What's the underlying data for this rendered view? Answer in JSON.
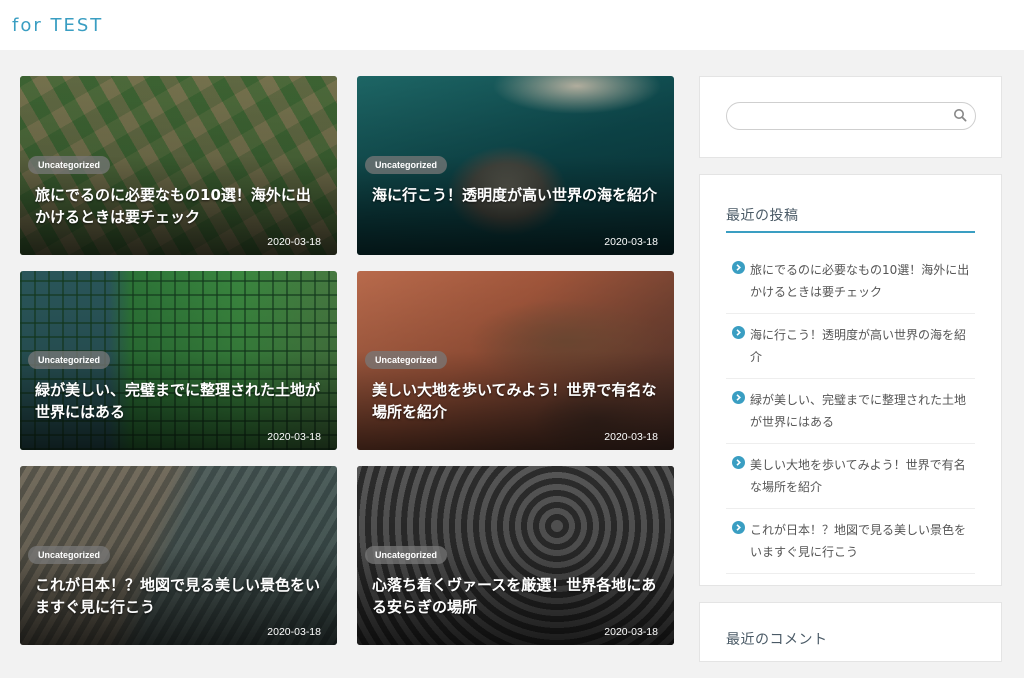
{
  "site": {
    "title": "for TEST"
  },
  "posts": [
    {
      "category": "Uncategorized",
      "title": "旅にでるのに必要なもの10選！海外に出かけるときは要チェック",
      "date": "2020-03-18"
    },
    {
      "category": "Uncategorized",
      "title": "海に行こう！透明度が高い世界の海を紹介",
      "date": "2020-03-18"
    },
    {
      "category": "Uncategorized",
      "title": "緑が美しい、完璧までに整理された土地が世界にはある",
      "date": "2020-03-18"
    },
    {
      "category": "Uncategorized",
      "title": "美しい大地を歩いてみよう！世界で有名な場所を紹介",
      "date": "2020-03-18"
    },
    {
      "category": "Uncategorized",
      "title": "これが日本！？地図で見る美しい景色をいますぐ見に行こう",
      "date": "2020-03-18"
    },
    {
      "category": "Uncategorized",
      "title": "心落ち着くヴァースを厳選！世界各地にある安らぎの場所",
      "date": "2020-03-18"
    }
  ],
  "sidebar": {
    "search": {
      "placeholder": "",
      "icon": "search-icon"
    },
    "recent": {
      "title": "最近の投稿",
      "items": [
        "旅にでるのに必要なもの10選！海外に出かけるときは要チェック",
        "海に行こう！透明度が高い世界の海を紹介",
        "緑が美しい、完璧までに整理された土地が世界にはある",
        "美しい大地を歩いてみよう！世界で有名な場所を紹介",
        "これが日本！？地図で見る美しい景色をいますぐ見に行こう"
      ]
    },
    "comments": {
      "title": "最近のコメント"
    }
  },
  "colors": {
    "accent": "#3a9ec2",
    "background": "#f2f2f2"
  }
}
